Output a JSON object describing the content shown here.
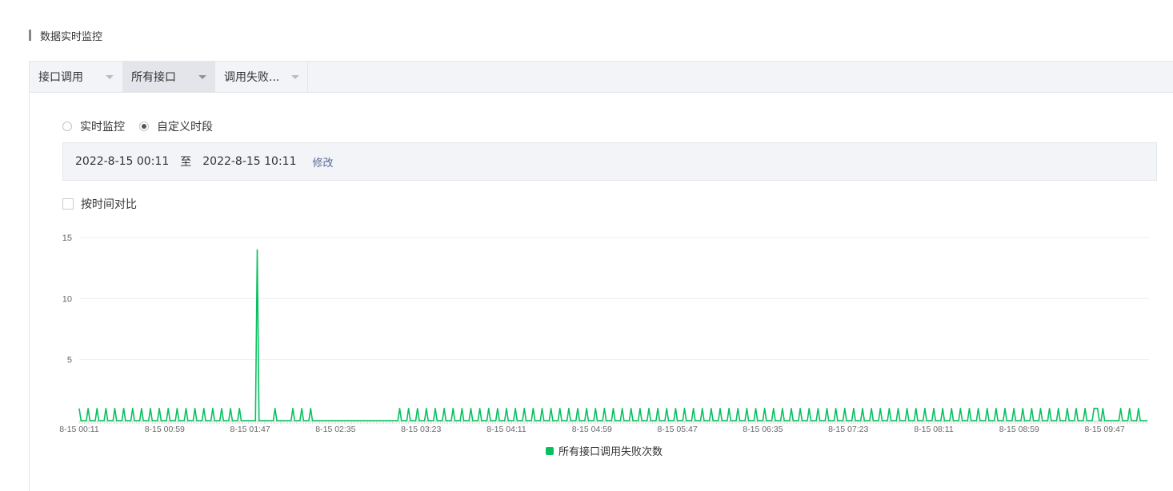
{
  "page": {
    "title": "数据实时监控"
  },
  "toolbar": {
    "dropdowns": [
      {
        "label": "接口调用"
      },
      {
        "label": "所有接口"
      },
      {
        "label": "调用失败..."
      }
    ]
  },
  "mode": {
    "options": [
      {
        "label": "实时监控",
        "selected": false
      },
      {
        "label": "自定义时段",
        "selected": true
      }
    ]
  },
  "range": {
    "start": "2022-8-15 00:11",
    "separator": "至",
    "end": "2022-8-15 10:11",
    "edit_label": "修改"
  },
  "compare": {
    "label": "按时间对比",
    "checked": false
  },
  "colors": {
    "series": "#07c160",
    "grid": "#eeeeee",
    "axis": "#cccccc"
  },
  "chart_data": {
    "type": "line",
    "ylim": [
      0,
      15
    ],
    "yticks": [
      5,
      10,
      15
    ],
    "xticks": [
      "8-15 00:11",
      "8-15 00:59",
      "8-15 01:47",
      "8-15 02:35",
      "8-15 03:23",
      "8-15 04:11",
      "8-15 04:59",
      "8-15 05:47",
      "8-15 06:35",
      "8-15 07:23",
      "8-15 08:11",
      "8-15 08:59",
      "8-15 09:47"
    ],
    "x_start": "8-15 00:11",
    "x_end": "8-15 10:11",
    "x_step_minutes": 1,
    "series": [
      {
        "name": "所有接口调用失败次数",
        "color": "#07c160",
        "nonzero_points": [
          [
            "00:11",
            1
          ],
          [
            "00:16",
            1
          ],
          [
            "00:21",
            1
          ],
          [
            "00:26",
            1
          ],
          [
            "00:31",
            1
          ],
          [
            "00:36",
            1
          ],
          [
            "00:41",
            1
          ],
          [
            "00:46",
            1
          ],
          [
            "00:51",
            1
          ],
          [
            "00:56",
            1
          ],
          [
            "01:01",
            1
          ],
          [
            "01:06",
            1
          ],
          [
            "01:11",
            1
          ],
          [
            "01:16",
            1
          ],
          [
            "01:21",
            1
          ],
          [
            "01:26",
            1
          ],
          [
            "01:31",
            1
          ],
          [
            "01:36",
            1
          ],
          [
            "01:41",
            1
          ],
          [
            "01:51",
            14
          ],
          [
            "02:01",
            1
          ],
          [
            "02:11",
            1
          ],
          [
            "02:16",
            1
          ],
          [
            "02:21",
            1
          ],
          [
            "03:11",
            1
          ],
          [
            "03:16",
            1
          ],
          [
            "03:21",
            1
          ],
          [
            "03:26",
            1
          ],
          [
            "03:31",
            1
          ],
          [
            "03:36",
            1
          ],
          [
            "03:41",
            1
          ],
          [
            "03:46",
            1
          ],
          [
            "03:51",
            1
          ],
          [
            "03:56",
            1
          ],
          [
            "04:01",
            1
          ],
          [
            "04:06",
            1
          ],
          [
            "04:11",
            1
          ],
          [
            "04:16",
            1
          ],
          [
            "04:21",
            1
          ],
          [
            "04:26",
            1
          ],
          [
            "04:31",
            1
          ],
          [
            "04:36",
            1
          ],
          [
            "04:41",
            1
          ],
          [
            "04:46",
            1
          ],
          [
            "04:51",
            1
          ],
          [
            "04:56",
            1
          ],
          [
            "05:01",
            1
          ],
          [
            "05:06",
            1
          ],
          [
            "05:11",
            1
          ],
          [
            "05:16",
            1
          ],
          [
            "05:21",
            1
          ],
          [
            "05:26",
            1
          ],
          [
            "05:31",
            1
          ],
          [
            "05:36",
            1
          ],
          [
            "05:41",
            1
          ],
          [
            "05:46",
            1
          ],
          [
            "05:51",
            1
          ],
          [
            "05:56",
            1
          ],
          [
            "06:01",
            1
          ],
          [
            "06:06",
            1
          ],
          [
            "06:11",
            1
          ],
          [
            "06:16",
            1
          ],
          [
            "06:21",
            1
          ],
          [
            "06:26",
            1
          ],
          [
            "06:31",
            1
          ],
          [
            "06:36",
            1
          ],
          [
            "06:41",
            1
          ],
          [
            "06:46",
            1
          ],
          [
            "06:51",
            1
          ],
          [
            "06:56",
            1
          ],
          [
            "07:01",
            1
          ],
          [
            "07:06",
            1
          ],
          [
            "07:11",
            1
          ],
          [
            "07:16",
            1
          ],
          [
            "07:21",
            1
          ],
          [
            "07:26",
            1
          ],
          [
            "07:31",
            1
          ],
          [
            "07:36",
            1
          ],
          [
            "07:41",
            1
          ],
          [
            "07:46",
            1
          ],
          [
            "07:51",
            1
          ],
          [
            "07:56",
            1
          ],
          [
            "08:01",
            1
          ],
          [
            "08:06",
            1
          ],
          [
            "08:11",
            1
          ],
          [
            "08:16",
            1
          ],
          [
            "08:21",
            1
          ],
          [
            "08:26",
            1
          ],
          [
            "08:31",
            1
          ],
          [
            "08:36",
            1
          ],
          [
            "08:41",
            1
          ],
          [
            "08:46",
            1
          ],
          [
            "08:51",
            1
          ],
          [
            "08:56",
            1
          ],
          [
            "09:01",
            1
          ],
          [
            "09:06",
            1
          ],
          [
            "09:11",
            1
          ],
          [
            "09:16",
            1
          ],
          [
            "09:21",
            1
          ],
          [
            "09:26",
            1
          ],
          [
            "09:31",
            1
          ],
          [
            "09:36",
            1
          ],
          [
            "09:41",
            1
          ],
          [
            "09:42",
            1
          ],
          [
            "09:43",
            1
          ],
          [
            "09:46",
            1
          ],
          [
            "09:56",
            1
          ],
          [
            "10:01",
            1
          ],
          [
            "10:06",
            1
          ]
        ]
      }
    ]
  }
}
